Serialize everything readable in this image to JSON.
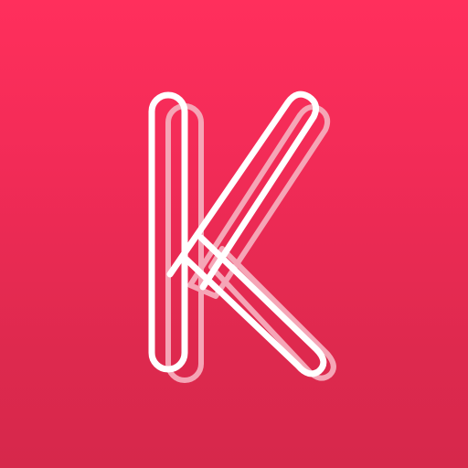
{
  "icon": {
    "logo": "letter-k-outline-logo",
    "lettering": "K",
    "colors": {
      "background_top": "#ff2f5c",
      "background_bottom": "#d6284b",
      "outline": "#ffffff",
      "shadow_outline": "#f5a5b6"
    }
  }
}
